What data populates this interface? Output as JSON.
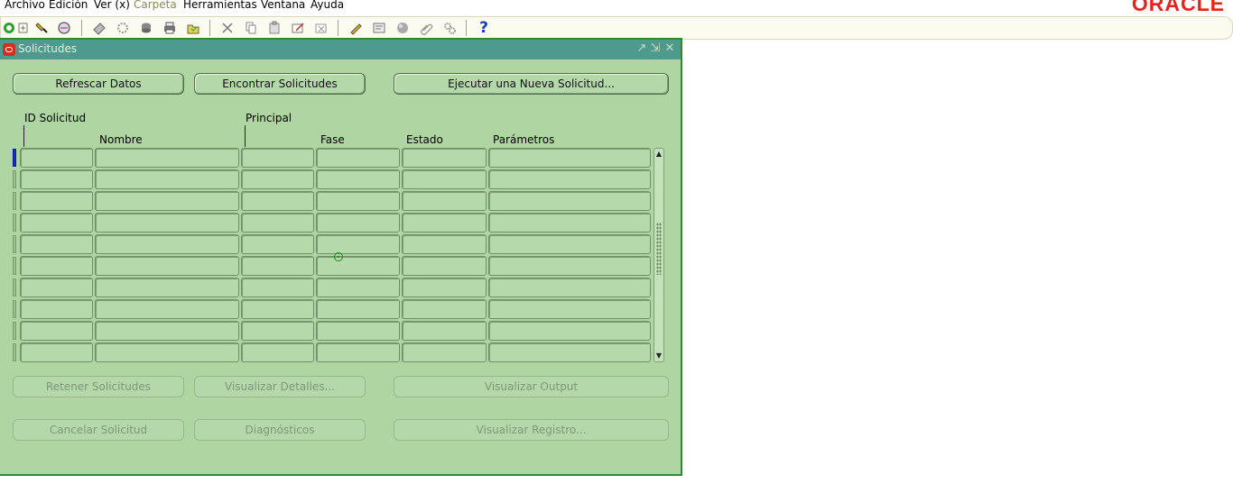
{
  "menubar": {
    "items": [
      {
        "label": "Archivo",
        "enabled": true
      },
      {
        "label": "Edición",
        "enabled": true
      },
      {
        "label": "Ver (x)",
        "enabled": true
      },
      {
        "label": "Carpeta",
        "enabled": false
      },
      {
        "label": "Herramientas",
        "enabled": true
      },
      {
        "label": "Ventana",
        "enabled": true
      },
      {
        "label": "Ayuda",
        "enabled": true
      }
    ],
    "brand": "ORACLE"
  },
  "toolbar": {
    "icons": [
      "navigator-icon",
      "flashlight-icon",
      "open-icon",
      "save-icon",
      "gears-icon",
      "database-icon",
      "print-icon",
      "folder-icon",
      "cut-icon",
      "copy-icon",
      "paste-icon",
      "edit-icon",
      "clear-icon",
      "pencil-icon",
      "translate-icon",
      "record-icon",
      "attach-icon",
      "folder-tools-icon",
      "help-icon"
    ],
    "help_glyph": "?"
  },
  "window": {
    "title": "Solicitudes",
    "controls": [
      "minimize",
      "maximize",
      "close"
    ]
  },
  "top_buttons": {
    "refresh": "Refrescar Datos",
    "find": "Encontrar Solicitudes",
    "submit_new": "Ejecutar una Nueva Solicitud..."
  },
  "table": {
    "headers": {
      "id": "ID Solicitud",
      "name": "Nombre",
      "parent": "Principal",
      "phase": "Fase",
      "status": "Estado",
      "params": "Parámetros"
    },
    "rows": [
      [
        "",
        "",
        "",
        "",
        "",
        ""
      ],
      [
        "",
        "",
        "",
        "",
        "",
        ""
      ],
      [
        "",
        "",
        "",
        "",
        "",
        ""
      ],
      [
        "",
        "",
        "",
        "",
        "",
        ""
      ],
      [
        "",
        "",
        "",
        "",
        "",
        ""
      ],
      [
        "",
        "",
        "",
        "",
        "",
        ""
      ],
      [
        "",
        "",
        "",
        "",
        "",
        ""
      ],
      [
        "",
        "",
        "",
        "",
        "",
        ""
      ],
      [
        "",
        "",
        "",
        "",
        "",
        ""
      ],
      [
        "",
        "",
        "",
        "",
        "",
        ""
      ]
    ]
  },
  "bottom_buttons": {
    "hold": "Retener Solicitudes",
    "view_details": "Visualizar Detalles...",
    "view_output": "Visualizar Output",
    "cancel": "Cancelar Solicitud",
    "diagnostics": "Diagnósticos",
    "view_log": "Visualizar Registro..."
  },
  "colors": {
    "window_bg": "#afd5a3",
    "titlebar": "#4f9a8e",
    "border": "#2f8a2f",
    "brand": "#e8231b"
  }
}
